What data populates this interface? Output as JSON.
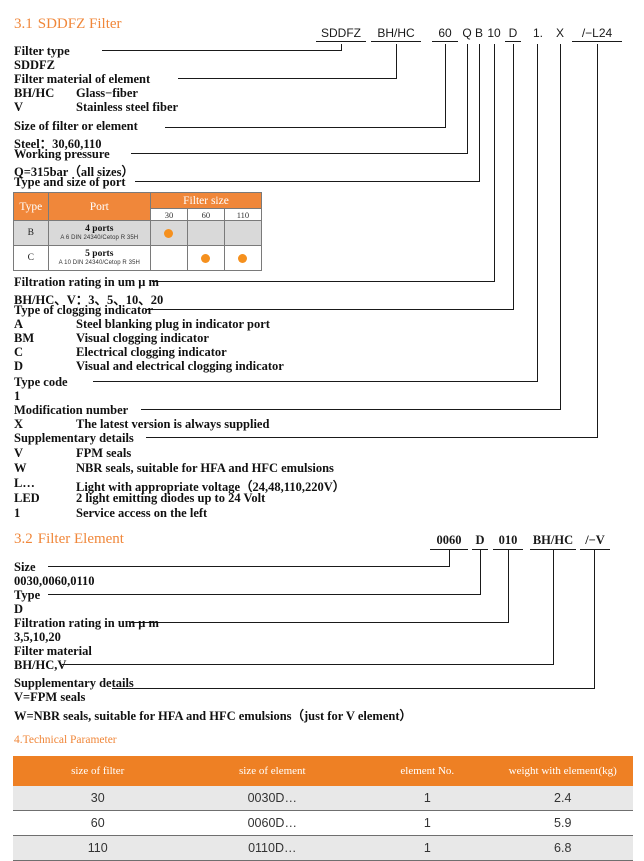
{
  "sections": {
    "s31": {
      "number": "3.1",
      "title": "SDDFZ Filter",
      "code_tokens": [
        {
          "t": "SDDFZ"
        },
        {
          "t": "BH/HC"
        },
        {
          "t": "60"
        },
        {
          "t": "Q"
        },
        {
          "t": "B"
        },
        {
          "t": "10"
        },
        {
          "t": "D"
        },
        {
          "t": "1."
        },
        {
          "t": "X"
        },
        {
          "t": "/−L24"
        }
      ],
      "lines": [
        "Filter type",
        "SDDFZ",
        "Filter material of element",
        "BH/HC",
        "Glass−fiber",
        "V",
        "Stainless steel fiber",
        "Size of filter or element",
        "Steel：30,60,110",
        "Working pressure",
        "Q=315bar（all sizes）",
        "Type and size of port",
        "Filtration rating in um μ m",
        "BH/HC、V：3、5、10、20",
        "Type of clogging indicator",
        "A",
        "Steel blanking plug in indicator port",
        "BM",
        "Visual clogging indicator",
        "C",
        "Electrical clogging indicator",
        "D",
        "Visual and electrical clogging indicator",
        "Type code",
        "1",
        "Modification number",
        "X",
        "The latest version is always supplied",
        "Supplementary details",
        "V",
        "FPM seals",
        "W",
        "NBR seals, suitable for HFA and HFC emulsions",
        "L…",
        "Light with appropriate voltage（24,48,110,220V）",
        "LED",
        "2 light emitting diodes up to 24 Volt",
        "1",
        "Service access on the left"
      ]
    },
    "s32": {
      "number": "3.2",
      "title": "Filter Element",
      "code_tokens": [
        {
          "t": "0060"
        },
        {
          "t": "D"
        },
        {
          "t": "010"
        },
        {
          "t": "BH/HC"
        },
        {
          "t": "/−V"
        }
      ],
      "lines": [
        "Size",
        "0030,0060,0110",
        "Type",
        "D",
        "Filtration rating in um μ m",
        "3,5,10,20",
        "Filter material",
        "BH/HC,V",
        "Supplementary details",
        "V=FPM seals",
        "W=NBR seals, suitable for HFA and HFC emulsions（just for V element）"
      ]
    },
    "s4": {
      "heading": "4.Technical Parameter"
    }
  },
  "port_table": {
    "headers": {
      "type": "Type",
      "port": "Port",
      "filter_size": "Filter size",
      "sizes": [
        "30",
        "60",
        "110"
      ]
    },
    "rows": [
      {
        "type": "B",
        "port_main": "4 ports",
        "port_sub": "A 6 DIN 24340/Cetop R 35H",
        "marks": [
          true,
          false,
          false
        ]
      },
      {
        "type": "C",
        "port_main": "5 ports",
        "port_sub": "A 10 DIN 24340/Cetop R 35H",
        "marks": [
          false,
          true,
          true
        ]
      }
    ]
  },
  "tech_table": {
    "columns": [
      "size of filter",
      "size of element",
      "element No.",
      "weight with element(kg)"
    ],
    "rows": [
      [
        "30",
        "0030D…",
        "1",
        "2.4"
      ],
      [
        "60",
        "0060D…",
        "1",
        "5.9"
      ],
      [
        "110",
        "0110D…",
        "1",
        "6.8"
      ]
    ]
  },
  "colors": {
    "accent_orange": "#F0873A",
    "table_header_orange": "#EE8024",
    "dot_orange": "#F5901E",
    "row_grey": "#d9d9d9"
  }
}
